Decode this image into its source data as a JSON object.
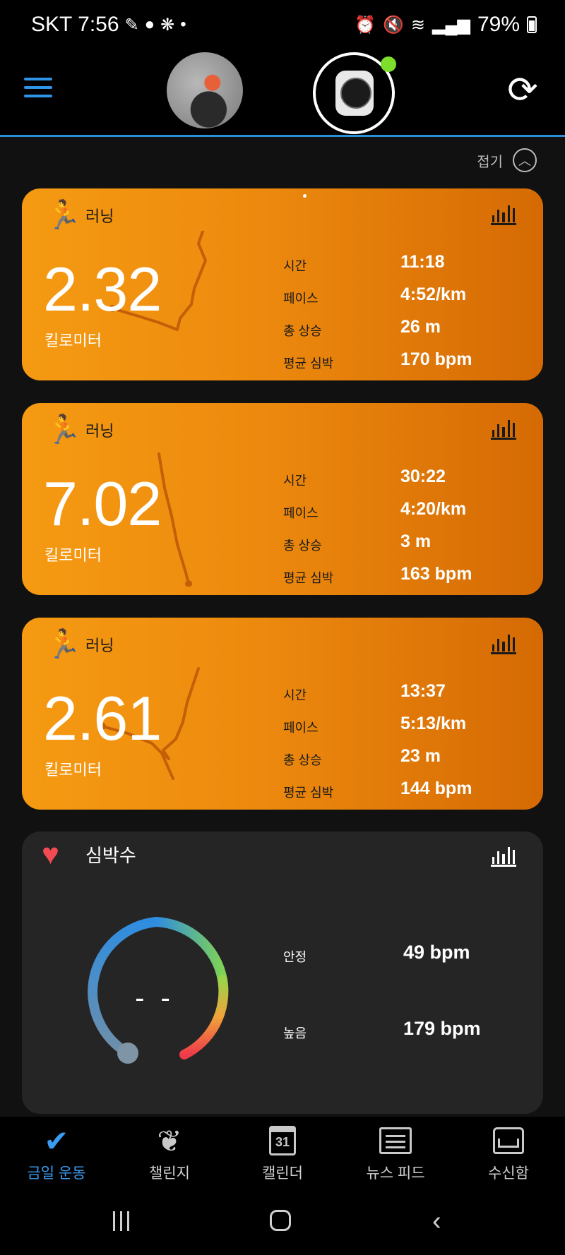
{
  "status_bar": {
    "carrier_time": "SKT 7:56",
    "notification_icons": [
      "pen-icon",
      "chat-icon",
      "shoe-icon"
    ],
    "dot": "•",
    "system_icons": [
      "alarm-icon",
      "mute-icon",
      "wifi-icon",
      "signal-icon"
    ],
    "battery_percent": "79%"
  },
  "app_bar": {
    "menu_icon": "hamburger-menu-icon",
    "device_status_color": "#7dde2c",
    "sync_icon": "sync-icon"
  },
  "collapse": {
    "label": "접기",
    "icon": "chevron-up-icon"
  },
  "activities": [
    {
      "type_label": "러닝",
      "distance": "2.32",
      "unit": "킬로미터",
      "stats": [
        {
          "label": "시간",
          "value": "11:18"
        },
        {
          "label": "페이스",
          "value": "4:52/km"
        },
        {
          "label": "총 상승",
          "value": "26 m"
        },
        {
          "label": "평균 심박",
          "value": "170 bpm"
        }
      ]
    },
    {
      "type_label": "러닝",
      "distance": "7.02",
      "unit": "킬로미터",
      "stats": [
        {
          "label": "시간",
          "value": "30:22"
        },
        {
          "label": "페이스",
          "value": "4:20/km"
        },
        {
          "label": "총 상승",
          "value": "3 m"
        },
        {
          "label": "평균 심박",
          "value": "163 bpm"
        }
      ]
    },
    {
      "type_label": "러닝",
      "distance": "2.61",
      "unit": "킬로미터",
      "stats": [
        {
          "label": "시간",
          "value": "13:37"
        },
        {
          "label": "페이스",
          "value": "5:13/km"
        },
        {
          "label": "총 상승",
          "value": "23 m"
        },
        {
          "label": "평균 심박",
          "value": "144 bpm"
        }
      ]
    }
  ],
  "heart_rate": {
    "title": "심박수",
    "current": "- -",
    "resting_label": "안정",
    "resting_value": "49 bpm",
    "high_label": "높음",
    "high_value": "179 bpm"
  },
  "bottom_nav": [
    {
      "label": "금일 운동",
      "icon": "checkmark-icon",
      "active": true
    },
    {
      "label": "챌린지",
      "icon": "laurel-icon",
      "active": false
    },
    {
      "label": "캘린더",
      "icon": "calendar-icon",
      "calendar_day": "31",
      "active": false
    },
    {
      "label": "뉴스 피드",
      "icon": "newspaper-icon",
      "active": false
    },
    {
      "label": "수신함",
      "icon": "inbox-icon",
      "active": false
    }
  ],
  "colors": {
    "accent": "#3b9bf0",
    "card_orange": "#f59a12",
    "card_orange_dark": "#d56a04",
    "heart": "#f24b53"
  }
}
